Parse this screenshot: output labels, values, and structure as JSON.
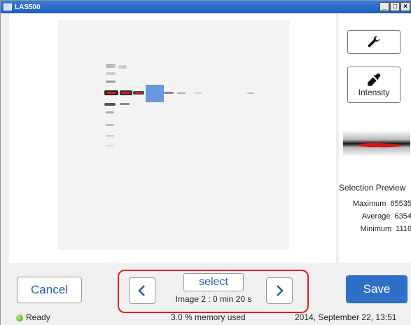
{
  "window": {
    "title": "LAS500",
    "minimize": "_",
    "maximize": "□",
    "close": "×"
  },
  "toolbar": {
    "intensity_label": "Intensity"
  },
  "preview": {
    "title": "Selection Preview"
  },
  "stats": [
    {
      "label": "Maximum",
      "value": "65535"
    },
    {
      "label": "Average",
      "value": "6354"
    },
    {
      "label": "Minimum",
      "value": "1116"
    }
  ],
  "controls": {
    "cancel_label": "Cancel",
    "save_label": "Save",
    "select_label": "select",
    "prev_label": "‹",
    "next_label": "›",
    "image_info": "Image 2 : 0 min 20 s"
  },
  "statusbar": {
    "status_text": "Ready",
    "memory_text": "3.0 % memory used",
    "datetime_text": "2014, September 22, 13:51"
  },
  "colors": {
    "accent": "#2f6fc7",
    "highlight": "#e02020",
    "selection": "#4f86d8"
  },
  "icons": {
    "settings": "wrench-icon",
    "intensity": "eyedropper-icon"
  }
}
